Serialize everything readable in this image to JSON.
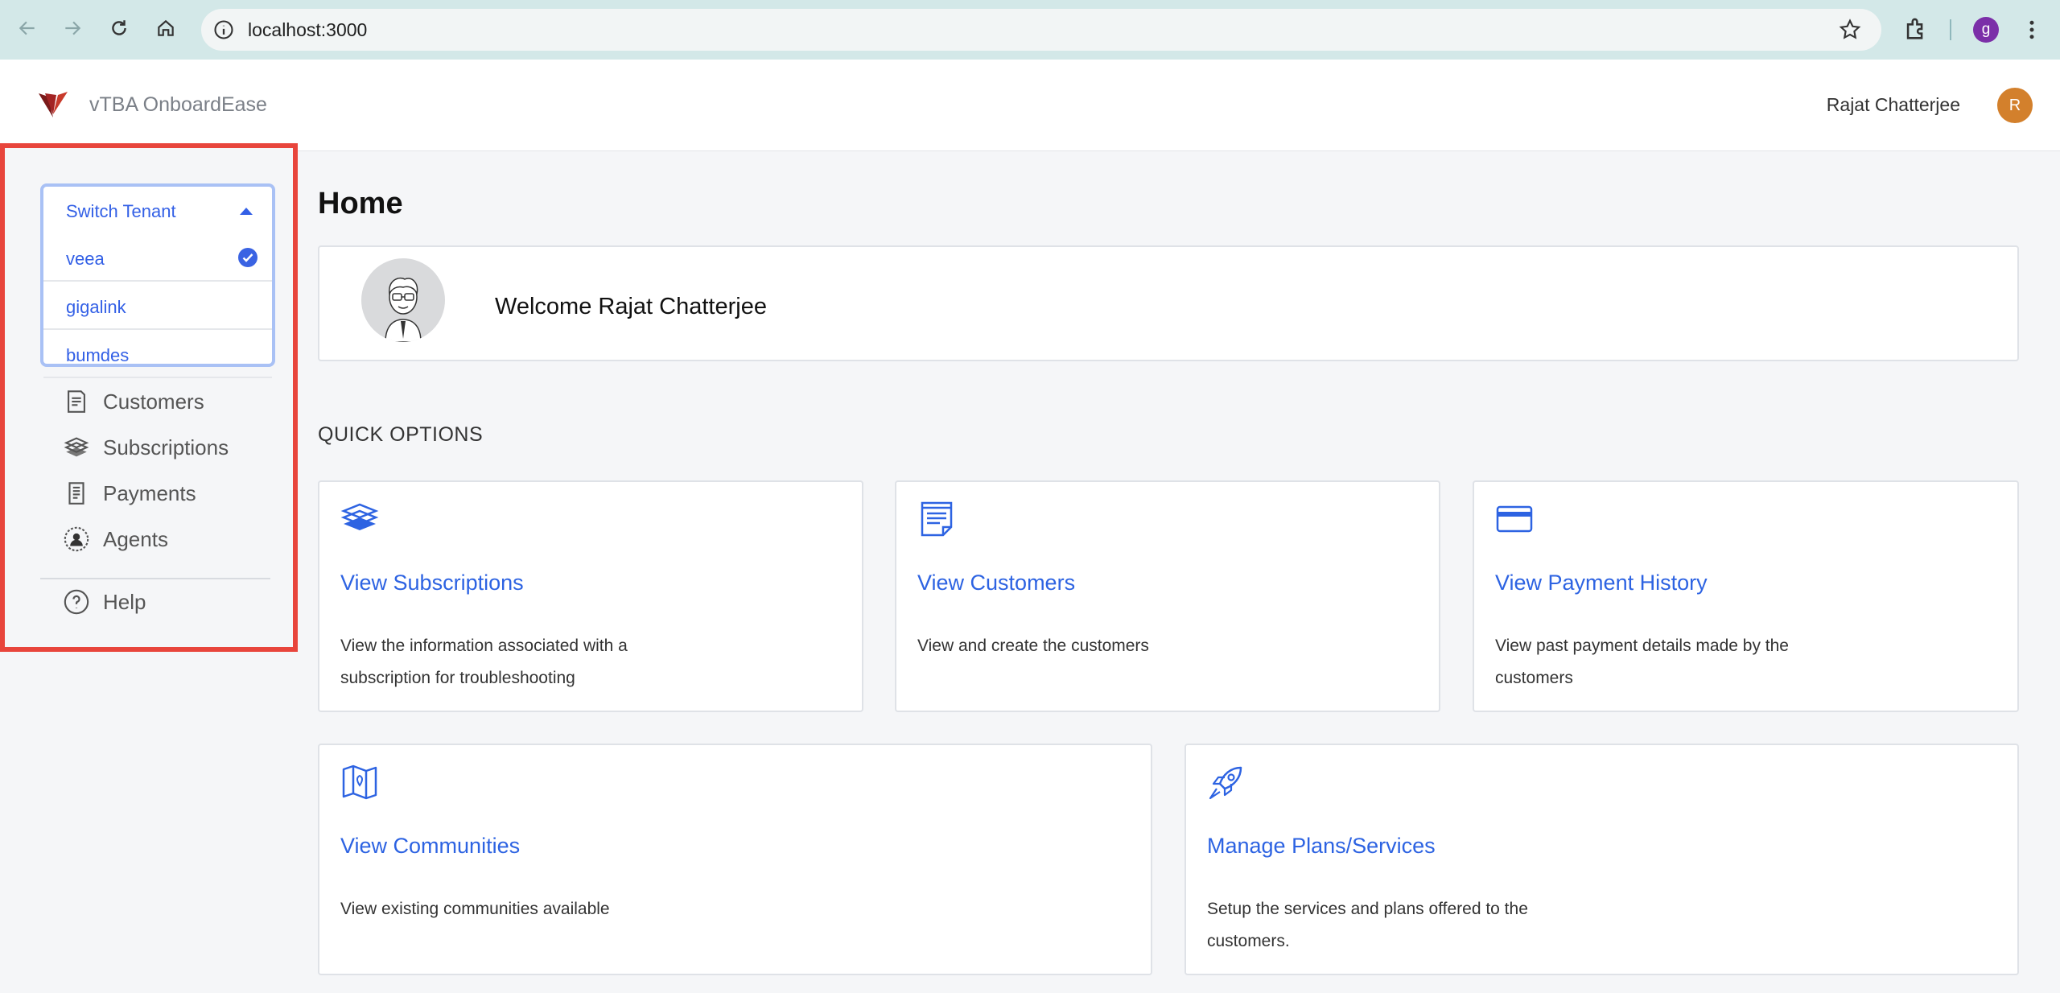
{
  "browser": {
    "url": "localhost:3000",
    "profile_initial": "g"
  },
  "header": {
    "brand_name": "vTBA OnboardEase",
    "user_name": "Rajat Chatterjee",
    "user_initial": "R"
  },
  "sidebar": {
    "tenant_switcher": {
      "title": "Switch Tenant",
      "options": [
        {
          "label": "veea",
          "selected": true
        },
        {
          "label": "gigalink",
          "selected": false
        },
        {
          "label": "bumdes",
          "selected": false
        }
      ]
    },
    "items": [
      {
        "label": "Customers",
        "icon": "customers-icon"
      },
      {
        "label": "Subscriptions",
        "icon": "subscriptions-icon"
      },
      {
        "label": "Payments",
        "icon": "payments-icon"
      },
      {
        "label": "Agents",
        "icon": "agents-icon"
      }
    ],
    "help_label": "Help"
  },
  "main": {
    "page_title": "Home",
    "welcome_text": "Welcome Rajat Chatterjee",
    "quick_options_heading": "QUICK OPTIONS",
    "cards": [
      {
        "title": "View Subscriptions",
        "description": "View the information associated with a subscription for troubleshooting",
        "icon": "subscriptions-stack-icon"
      },
      {
        "title": "View Customers",
        "description": "View and create the customers",
        "icon": "customers-doc-icon"
      },
      {
        "title": "View Payment History",
        "description": "View past payment details made by the customers",
        "icon": "credit-card-icon"
      },
      {
        "title": "View Communities",
        "description": "View existing communities available",
        "icon": "map-icon"
      },
      {
        "title": "Manage Plans/Services",
        "description": "Setup the services and plans offered to the customers.",
        "icon": "rocket-icon"
      }
    ]
  },
  "colors": {
    "accent": "#2d63e2",
    "highlight_border": "#e8453c",
    "avatar": "#d3802c"
  }
}
